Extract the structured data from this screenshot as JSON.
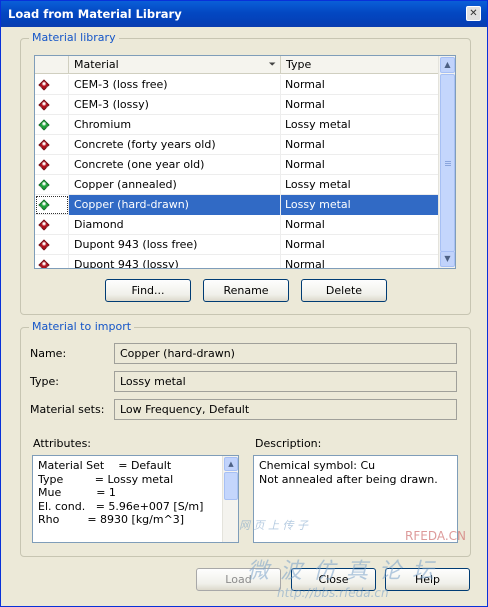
{
  "window": {
    "title": "Load from Material Library",
    "close_glyph": "✕"
  },
  "library": {
    "group_label": "Material library",
    "columns": {
      "icon": "",
      "material": "Material",
      "type": "Type"
    },
    "rows": [
      {
        "material": "CEM-3 (loss free)",
        "type": "Normal",
        "color": "#b0101c"
      },
      {
        "material": "CEM-3 (lossy)",
        "type": "Normal",
        "color": "#b0101c"
      },
      {
        "material": "Chromium",
        "type": "Lossy metal",
        "color": "#1ea33a"
      },
      {
        "material": "Concrete (forty years old)",
        "type": "Normal",
        "color": "#b0101c"
      },
      {
        "material": "Concrete (one year old)",
        "type": "Normal",
        "color": "#b0101c"
      },
      {
        "material": "Copper (annealed)",
        "type": "Lossy metal",
        "color": "#1ea33a"
      },
      {
        "material": "Copper (hard-drawn)",
        "type": "Lossy metal",
        "color": "#1ea33a",
        "selected": true
      },
      {
        "material": "Diamond",
        "type": "Normal",
        "color": "#b0101c"
      },
      {
        "material": "Dupont 943 (loss free)",
        "type": "Normal",
        "color": "#b0101c"
      },
      {
        "material": "Dupont 943 (lossy)",
        "type": "Normal",
        "color": "#b0101c"
      }
    ],
    "buttons": {
      "find": "Find...",
      "rename": "Rename",
      "delete": "Delete"
    }
  },
  "import": {
    "group_label": "Material to import",
    "name_label": "Name:",
    "name_value": "Copper (hard-drawn)",
    "type_label": "Type:",
    "type_value": "Lossy metal",
    "sets_label": "Material sets:",
    "sets_value": "Low Frequency, Default",
    "attributes_label": "Attributes:",
    "attributes": [
      "Material Set    = Default",
      "Type         = Lossy metal",
      "Mue          = 1",
      "El. cond.   = 5.96e+007 [S/m]",
      "Rho        = 8930 [kg/m^3]"
    ],
    "description_label": "Description:",
    "description": [
      "Chemical symbol: Cu",
      "Not annealed after being drawn."
    ]
  },
  "footer": {
    "load": "Load",
    "close": "Close",
    "help": "Help"
  },
  "watermark": {
    "top": "网 页 上 传 子",
    "brand": "RFEDA.CN",
    "chinese": "微 波 仿 真 论 坛",
    "url": "http://bbs.rfeda.cn"
  }
}
